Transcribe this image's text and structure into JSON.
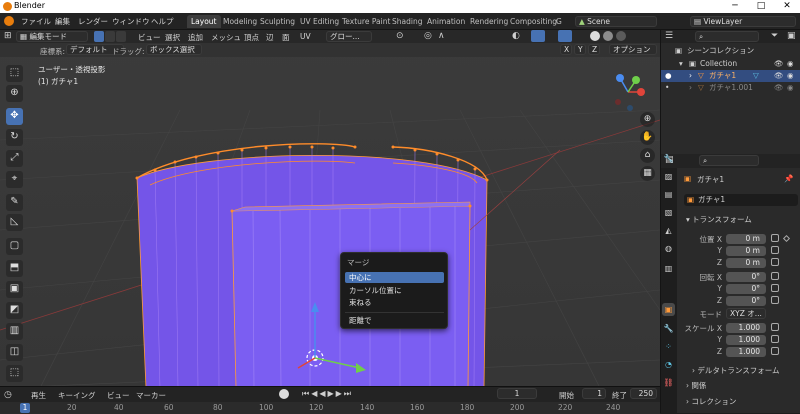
{
  "window": {
    "title": "Blender",
    "minimize": "─",
    "maximize": "□",
    "close": "✕"
  },
  "menus": [
    "ファイル",
    "編集",
    "レンダー",
    "ウィンドウ",
    "ヘルプ"
  ],
  "workspaces": [
    "Layout",
    "Modeling",
    "Sculpting",
    "UV Editing",
    "Texture Paint",
    "Shading",
    "Animation",
    "Rendering",
    "Compositing",
    "G"
  ],
  "scene": "Scene",
  "view_layer": "ViewLayer",
  "viewport_header": {
    "mode": "編集モード",
    "menus": [
      "ビュー",
      "選択",
      "追加",
      "メッシュ",
      "頂点",
      "辺",
      "面",
      "UV"
    ],
    "transform": "グロー...",
    "coord_label": "座標系:",
    "coord_value": "デフォルト",
    "drag_label": "ドラッグ:",
    "drag_value": "ボックス選択",
    "options": "オプション",
    "axes": [
      "X",
      "Y",
      "Z"
    ]
  },
  "overlay_text": {
    "view": "ユーザー・透視投影",
    "object": "(1) ガチャ1"
  },
  "popup": {
    "title": "マージ",
    "items": [
      "中心に",
      "カーソル位置に",
      "束ねる",
      "距離で"
    ],
    "selected": "中心に"
  },
  "timeline": {
    "menus": [
      "再生",
      "キーイング",
      "ビュー",
      "マーカー"
    ],
    "current_frame": "1",
    "start_label": "開始",
    "start": "1",
    "end_label": "終了",
    "end": "250",
    "ticks": [
      "0",
      "20",
      "40",
      "60",
      "80",
      "100",
      "120",
      "140",
      "160",
      "180",
      "200",
      "220",
      "240"
    ]
  },
  "outliner": {
    "scene_collection": "シーンコレクション",
    "items": [
      {
        "name": "Collection"
      },
      {
        "name": "ガチャ1"
      },
      {
        "name": "ガチャ1.001"
      }
    ]
  },
  "properties": {
    "object_name": "ガチャ1",
    "field_name": "ガチャ1",
    "section": "トランスフォーム",
    "location_label": "位置 X",
    "location": [
      "0 m",
      "0 m",
      "0 m"
    ],
    "rotation_label": "回転 X",
    "rotation": [
      "0°",
      "0°",
      "0°"
    ],
    "mode_label": "モード",
    "mode_value": "XYZ オ...",
    "scale_label": "スケール X",
    "scale": [
      "1.000",
      "1.000",
      "1.000"
    ],
    "axis_labels": [
      "Y",
      "Z"
    ],
    "delta": "デルタトランスフォーム",
    "relations": "関係",
    "collection": "コレクション"
  },
  "colors": {
    "accent": "#4772b3",
    "mesh": "#7b55f1",
    "edge": "#f08a2c",
    "header": "#232323",
    "panel": "#2a2a2a"
  }
}
